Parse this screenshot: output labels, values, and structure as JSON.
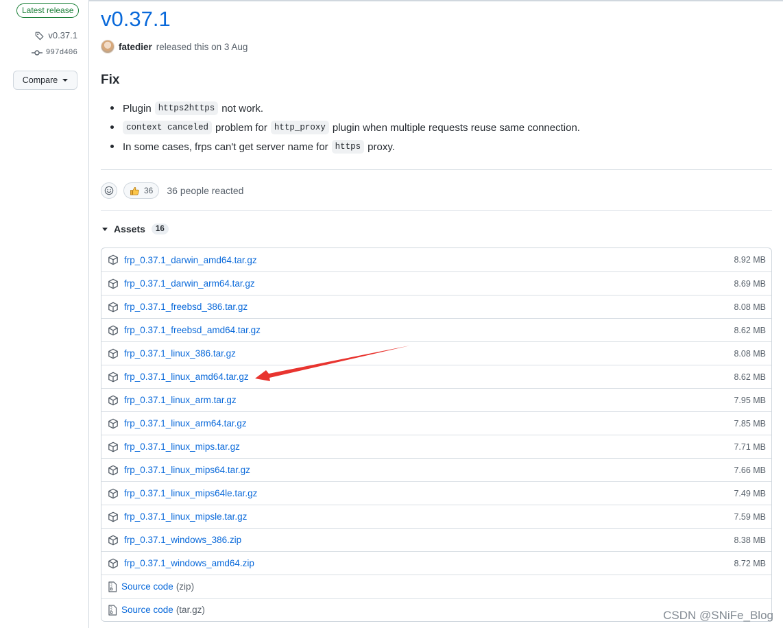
{
  "sidebar": {
    "badge": "Latest release",
    "tag": "v0.37.1",
    "commit": "997d406",
    "compare_label": "Compare"
  },
  "release": {
    "title": "v0.37.1",
    "author": "fatedier",
    "released_text": "released this on 3 Aug"
  },
  "notes": {
    "heading": "Fix",
    "items": [
      {
        "parts": [
          "Plugin",
          "https2https",
          "not work."
        ]
      },
      {
        "parts": [
          "context canceled",
          "problem for",
          "http_proxy",
          "plugin when multiple requests reuse same connection."
        ]
      },
      {
        "parts": [
          "In some cases, frps can't get server name for",
          "https",
          "proxy."
        ]
      }
    ]
  },
  "reactions": {
    "thumbs_count": "36",
    "summary": "36 people reacted"
  },
  "assets": {
    "label": "Assets",
    "count": "16",
    "files": [
      {
        "name": "frp_0.37.1_darwin_amd64.tar.gz",
        "size": "8.92 MB"
      },
      {
        "name": "frp_0.37.1_darwin_arm64.tar.gz",
        "size": "8.69 MB"
      },
      {
        "name": "frp_0.37.1_freebsd_386.tar.gz",
        "size": "8.08 MB"
      },
      {
        "name": "frp_0.37.1_freebsd_amd64.tar.gz",
        "size": "8.62 MB"
      },
      {
        "name": "frp_0.37.1_linux_386.tar.gz",
        "size": "8.08 MB"
      },
      {
        "name": "frp_0.37.1_linux_amd64.tar.gz",
        "size": "8.62 MB"
      },
      {
        "name": "frp_0.37.1_linux_arm.tar.gz",
        "size": "7.95 MB"
      },
      {
        "name": "frp_0.37.1_linux_arm64.tar.gz",
        "size": "7.85 MB"
      },
      {
        "name": "frp_0.37.1_linux_mips.tar.gz",
        "size": "7.71 MB"
      },
      {
        "name": "frp_0.37.1_linux_mips64.tar.gz",
        "size": "7.66 MB"
      },
      {
        "name": "frp_0.37.1_linux_mips64le.tar.gz",
        "size": "7.49 MB"
      },
      {
        "name": "frp_0.37.1_linux_mipsle.tar.gz",
        "size": "7.59 MB"
      },
      {
        "name": "frp_0.37.1_windows_386.zip",
        "size": "8.38 MB"
      },
      {
        "name": "frp_0.37.1_windows_amd64.zip",
        "size": "8.72 MB"
      }
    ],
    "source": [
      {
        "label": "Source code",
        "suffix": "(zip)"
      },
      {
        "label": "Source code",
        "suffix": "(tar.gz)"
      }
    ]
  },
  "colors": {
    "link": "#0969da",
    "latest_green": "#1a7f37",
    "annotation_arrow": "#e8342f"
  },
  "watermark": "CSDN @SNiFe_Blog"
}
